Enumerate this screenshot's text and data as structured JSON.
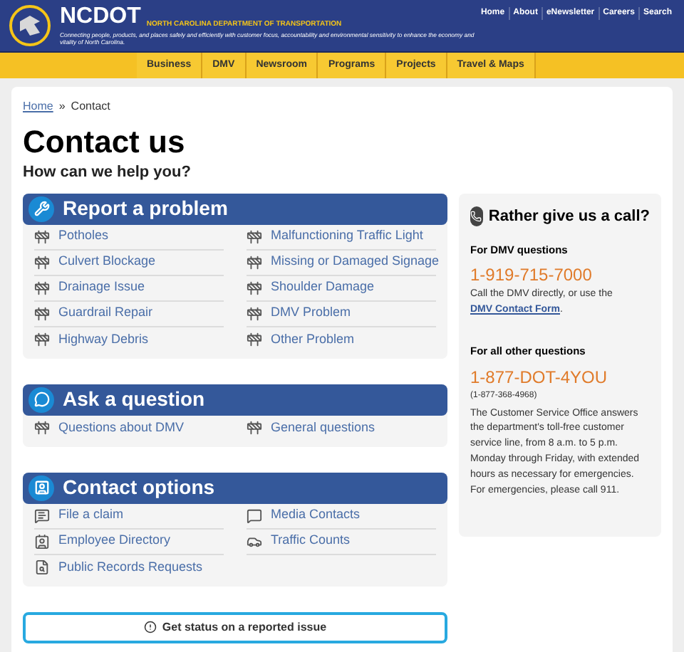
{
  "header": {
    "logo_text": "NCDOT",
    "department": "NORTH CAROLINA DEPARTMENT OF TRANSPORTATION",
    "tagline": "Connecting people, products, and places safely and efficiently with customer focus, accountability and environmental sensitivity to enhance the economy and vitality of North Carolina.",
    "utility_links": [
      "Home",
      "About",
      "eNewsletter",
      "Careers",
      "Search"
    ]
  },
  "nav": [
    "Business",
    "DMV",
    "Newsroom",
    "Programs",
    "Projects",
    "Travel & Maps"
  ],
  "breadcrumb": {
    "link": "Home",
    "separator": "»",
    "current": "Contact"
  },
  "title": "Contact us",
  "subtitle": "How can we help you?",
  "panels": [
    {
      "title": "Report a problem",
      "items": [
        "Potholes",
        "Malfunctioning Traffic Light",
        "Culvert Blockage",
        "Missing or Damaged Signage",
        "Drainage Issue",
        "Shoulder Damage",
        "Guardrail Repair",
        "DMV Problem",
        "Highway Debris",
        "Other Problem"
      ]
    },
    {
      "title": "Ask a question",
      "items": [
        "Questions about DMV",
        "General questions"
      ]
    },
    {
      "title": "Contact options",
      "items": [
        "File a claim",
        "Media Contacts",
        "Employee Directory",
        "Traffic Counts",
        "Public Records Requests"
      ]
    }
  ],
  "status_button": "Get status on a reported issue",
  "call_box": {
    "title": "Rather give us a call?",
    "dmv": {
      "heading": "For DMV questions",
      "phone": "1-919-715-7000",
      "text_before": "Call the DMV directly, or use the",
      "link": "DMV Contact Form",
      "text_after": "."
    },
    "other": {
      "heading": "For all other questions",
      "phone": "1-877-DOT-4YOU",
      "phone_digits": "(1-877-368-4968)",
      "text": "The Customer Service Office answers the department's toll-free customer service line, from 8 a.m. to 5 p.m. Monday through Friday, with extended hours as necessary for emergencies. For emergencies, please call 911."
    }
  }
}
